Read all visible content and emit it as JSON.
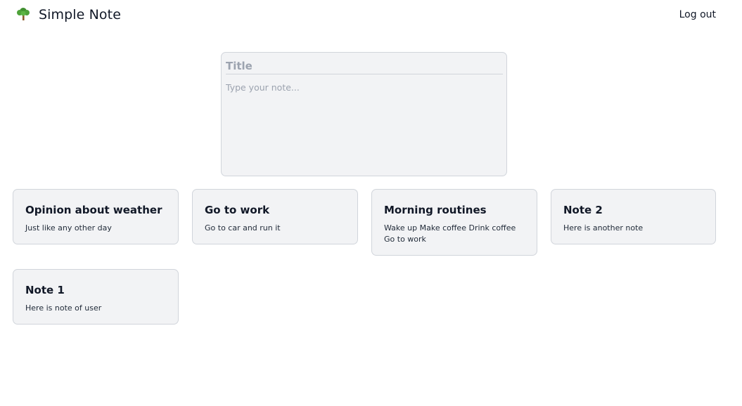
{
  "header": {
    "app_title": "Simple Note",
    "logo_icon": "tree-icon",
    "logout_label": "Log out"
  },
  "composer": {
    "title_placeholder": "Title",
    "note_placeholder": "Type your note..."
  },
  "notes": [
    {
      "title": "Opinion about weather",
      "body": "Just like any other day"
    },
    {
      "title": "Go to work",
      "body": "Go to car and run it"
    },
    {
      "title": "Morning routines",
      "body": "Wake up Make coffee Drink coffee Go to work"
    },
    {
      "title": "Note 2",
      "body": "Here is another note"
    },
    {
      "title": "Note 1",
      "body": "Here is note of user"
    }
  ],
  "colors": {
    "card_background": "#f2f3f5",
    "card_border": "#d1d5db",
    "text": "#111827",
    "placeholder": "#9ca3af"
  }
}
